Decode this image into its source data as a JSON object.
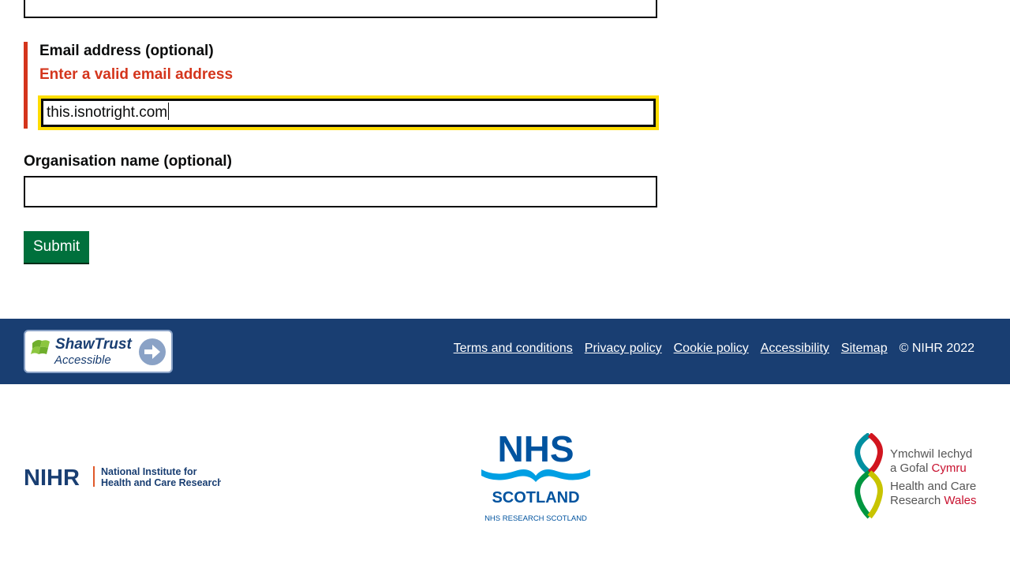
{
  "form": {
    "email": {
      "label": "Email address (optional)",
      "error": "Enter a valid email address",
      "value": "this.isnotright.com"
    },
    "organisation": {
      "label": "Organisation name (optional)",
      "value": ""
    },
    "submit_label": "Submit"
  },
  "footer": {
    "badge": {
      "brand": "ShawTrust",
      "sub": "Accessible"
    },
    "links": [
      "Terms and conditions",
      "Privacy policy",
      "Cookie policy",
      "Accessibility",
      "Sitemap"
    ],
    "copyright": "© NIHR 2022"
  },
  "logos": {
    "nihr": {
      "acronym": "NIHR",
      "line1": "National Institute for",
      "line2": "Health and Care Research"
    },
    "nhs_scotland": {
      "nhs": "NHS",
      "scotland": "SCOTLAND",
      "sub": "NHS RESEARCH SCOTLAND"
    },
    "wales": {
      "line1": "Ymchwil Iechyd",
      "line2a": "a Gofal",
      "line2b": "Cymru",
      "line3": "Health and Care",
      "line4a": "Research",
      "line4b": "Wales"
    }
  },
  "colors": {
    "error": "#d4351c",
    "focus": "#ffdd00",
    "submit": "#00703c",
    "footer": "#193e72"
  }
}
